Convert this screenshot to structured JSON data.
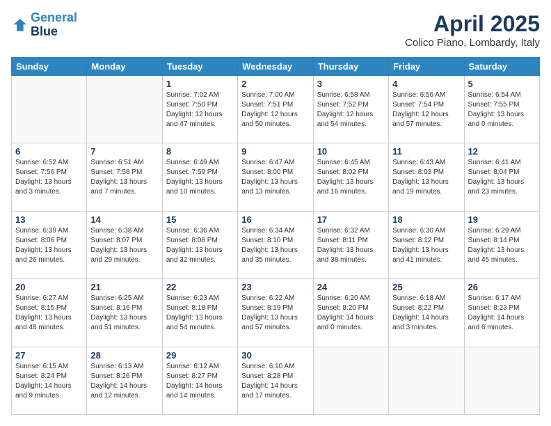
{
  "logo": {
    "line1": "General",
    "line2": "Blue"
  },
  "title": "April 2025",
  "subtitle": "Colico Piano, Lombardy, Italy",
  "days_header": [
    "Sunday",
    "Monday",
    "Tuesday",
    "Wednesday",
    "Thursday",
    "Friday",
    "Saturday"
  ],
  "weeks": [
    [
      {
        "day": "",
        "info": ""
      },
      {
        "day": "",
        "info": ""
      },
      {
        "day": "1",
        "info": "Sunrise: 7:02 AM\nSunset: 7:50 PM\nDaylight: 12 hours and 47 minutes."
      },
      {
        "day": "2",
        "info": "Sunrise: 7:00 AM\nSunset: 7:51 PM\nDaylight: 12 hours and 50 minutes."
      },
      {
        "day": "3",
        "info": "Sunrise: 6:58 AM\nSunset: 7:52 PM\nDaylight: 12 hours and 54 minutes."
      },
      {
        "day": "4",
        "info": "Sunrise: 6:56 AM\nSunset: 7:54 PM\nDaylight: 12 hours and 57 minutes."
      },
      {
        "day": "5",
        "info": "Sunrise: 6:54 AM\nSunset: 7:55 PM\nDaylight: 13 hours and 0 minutes."
      }
    ],
    [
      {
        "day": "6",
        "info": "Sunrise: 6:52 AM\nSunset: 7:56 PM\nDaylight: 13 hours and 3 minutes."
      },
      {
        "day": "7",
        "info": "Sunrise: 6:51 AM\nSunset: 7:58 PM\nDaylight: 13 hours and 7 minutes."
      },
      {
        "day": "8",
        "info": "Sunrise: 6:49 AM\nSunset: 7:59 PM\nDaylight: 13 hours and 10 minutes."
      },
      {
        "day": "9",
        "info": "Sunrise: 6:47 AM\nSunset: 8:00 PM\nDaylight: 13 hours and 13 minutes."
      },
      {
        "day": "10",
        "info": "Sunrise: 6:45 AM\nSunset: 8:02 PM\nDaylight: 13 hours and 16 minutes."
      },
      {
        "day": "11",
        "info": "Sunrise: 6:43 AM\nSunset: 8:03 PM\nDaylight: 13 hours and 19 minutes."
      },
      {
        "day": "12",
        "info": "Sunrise: 6:41 AM\nSunset: 8:04 PM\nDaylight: 13 hours and 23 minutes."
      }
    ],
    [
      {
        "day": "13",
        "info": "Sunrise: 6:39 AM\nSunset: 8:06 PM\nDaylight: 13 hours and 26 minutes."
      },
      {
        "day": "14",
        "info": "Sunrise: 6:38 AM\nSunset: 8:07 PM\nDaylight: 13 hours and 29 minutes."
      },
      {
        "day": "15",
        "info": "Sunrise: 6:36 AM\nSunset: 8:08 PM\nDaylight: 13 hours and 32 minutes."
      },
      {
        "day": "16",
        "info": "Sunrise: 6:34 AM\nSunset: 8:10 PM\nDaylight: 13 hours and 35 minutes."
      },
      {
        "day": "17",
        "info": "Sunrise: 6:32 AM\nSunset: 8:11 PM\nDaylight: 13 hours and 38 minutes."
      },
      {
        "day": "18",
        "info": "Sunrise: 6:30 AM\nSunset: 8:12 PM\nDaylight: 13 hours and 41 minutes."
      },
      {
        "day": "19",
        "info": "Sunrise: 6:29 AM\nSunset: 8:14 PM\nDaylight: 13 hours and 45 minutes."
      }
    ],
    [
      {
        "day": "20",
        "info": "Sunrise: 6:27 AM\nSunset: 8:15 PM\nDaylight: 13 hours and 48 minutes."
      },
      {
        "day": "21",
        "info": "Sunrise: 6:25 AM\nSunset: 8:16 PM\nDaylight: 13 hours and 51 minutes."
      },
      {
        "day": "22",
        "info": "Sunrise: 6:23 AM\nSunset: 8:18 PM\nDaylight: 13 hours and 54 minutes."
      },
      {
        "day": "23",
        "info": "Sunrise: 6:22 AM\nSunset: 8:19 PM\nDaylight: 13 hours and 57 minutes."
      },
      {
        "day": "24",
        "info": "Sunrise: 6:20 AM\nSunset: 8:20 PM\nDaylight: 14 hours and 0 minutes."
      },
      {
        "day": "25",
        "info": "Sunrise: 6:18 AM\nSunset: 8:22 PM\nDaylight: 14 hours and 3 minutes."
      },
      {
        "day": "26",
        "info": "Sunrise: 6:17 AM\nSunset: 8:23 PM\nDaylight: 14 hours and 6 minutes."
      }
    ],
    [
      {
        "day": "27",
        "info": "Sunrise: 6:15 AM\nSunset: 8:24 PM\nDaylight: 14 hours and 9 minutes."
      },
      {
        "day": "28",
        "info": "Sunrise: 6:13 AM\nSunset: 8:26 PM\nDaylight: 14 hours and 12 minutes."
      },
      {
        "day": "29",
        "info": "Sunrise: 6:12 AM\nSunset: 8:27 PM\nDaylight: 14 hours and 14 minutes."
      },
      {
        "day": "30",
        "info": "Sunrise: 6:10 AM\nSunset: 8:28 PM\nDaylight: 14 hours and 17 minutes."
      },
      {
        "day": "",
        "info": ""
      },
      {
        "day": "",
        "info": ""
      },
      {
        "day": "",
        "info": ""
      }
    ]
  ]
}
